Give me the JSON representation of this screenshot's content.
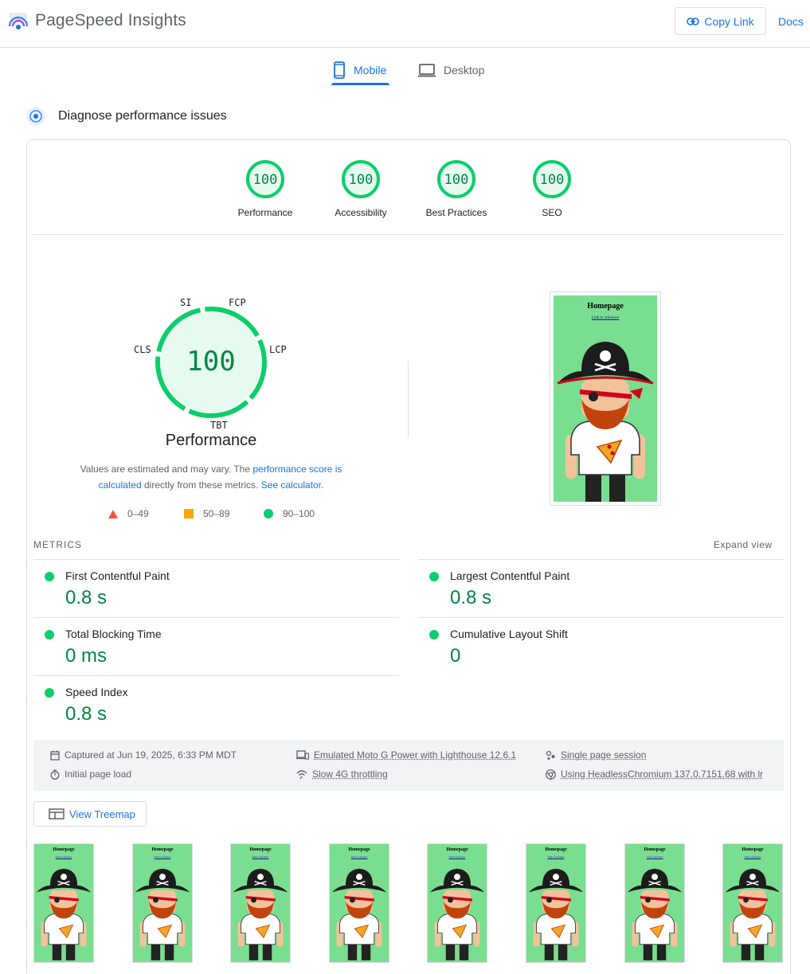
{
  "header": {
    "app_title": "PageSpeed Insights",
    "copy_link_label": "Copy Link",
    "docs_label": "Docs"
  },
  "tabs": [
    {
      "label": "Mobile",
      "icon": "smartphone-icon",
      "selected": true
    },
    {
      "label": "Desktop",
      "icon": "laptop-icon",
      "selected": false
    }
  ],
  "section_title": "Diagnose performance issues",
  "categories": [
    {
      "score": "100",
      "label": "Performance"
    },
    {
      "score": "100",
      "label": "Accessibility"
    },
    {
      "score": "100",
      "label": "Best Practices"
    },
    {
      "score": "100",
      "label": "SEO"
    }
  ],
  "big_gauge": {
    "score": "100",
    "title": "Performance",
    "letters": {
      "si": "SI",
      "fcp": "FCP",
      "lcp": "LCP",
      "tbt": "TBT",
      "cls": "CLS"
    }
  },
  "disclaimer": {
    "text_1": "Values are estimated and may vary. The ",
    "link_1": "performance score is calculated",
    "text_2": " directly from these metrics. ",
    "link_2": "See calculator."
  },
  "legend": [
    {
      "range": "0–49",
      "shape": "triangle",
      "color": "#ff4e42"
    },
    {
      "range": "50–89",
      "shape": "square",
      "color": "#ffa400"
    },
    {
      "range": "90–100",
      "shape": "circle",
      "color": "#0cce6b"
    }
  ],
  "screenshot": {
    "title": "Homepage",
    "link": "Link to reference"
  },
  "metrics": {
    "header": "METRICS",
    "expand_label": "Expand view",
    "items": [
      {
        "label": "First Contentful Paint",
        "value": "0.8 s"
      },
      {
        "label": "Largest Contentful Paint",
        "value": "0.8 s"
      },
      {
        "label": "Total Blocking Time",
        "value": "0 ms"
      },
      {
        "label": "Cumulative Layout Shift",
        "value": "0"
      },
      {
        "label": "Speed Index",
        "value": "0.8 s"
      }
    ]
  },
  "info_bar": {
    "captured": "Captured at Jun 19, 2025, 6:33 PM MDT",
    "initial_load": "Initial page load",
    "device": "Emulated Moto G Power with Lighthouse 12.6.1",
    "throttling": "Slow 4G throttling",
    "session": "Single page session",
    "browser": "Using HeadlessChromium 137.0.7151.68 with lr"
  },
  "treemap_label": "View Treemap",
  "filmstrip_count": 8,
  "colors": {
    "accent": "#1a73e8",
    "pass": "#0cce6b",
    "pass_text": "#018642",
    "pass_fill": "#e6faf0",
    "shot_bg": "#79de8f"
  }
}
